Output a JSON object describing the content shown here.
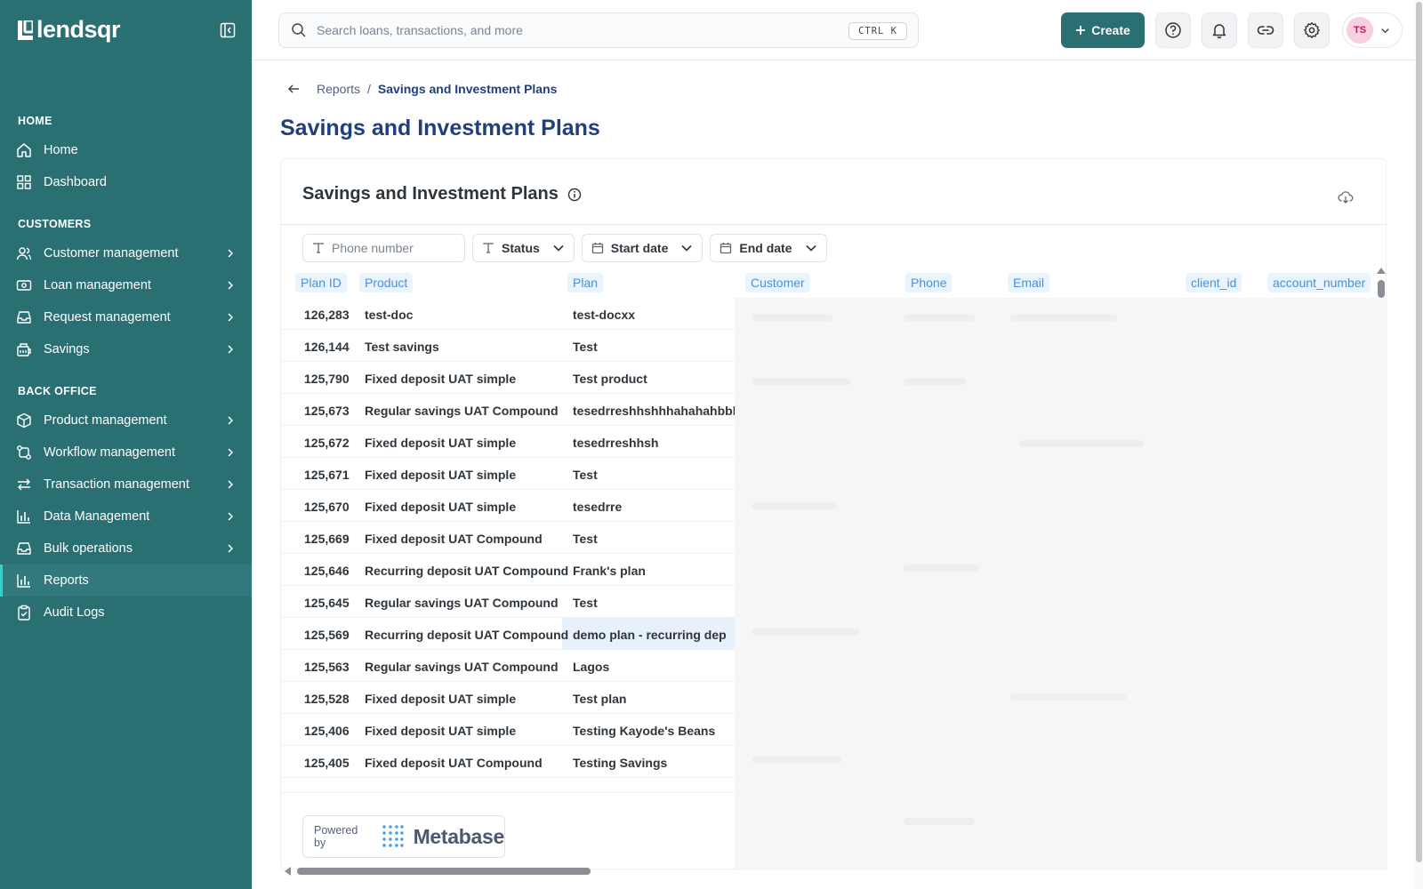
{
  "brand": {
    "name": "lendsqr"
  },
  "sidebar": {
    "sections": {
      "home": "HOME",
      "customers": "CUSTOMERS",
      "back_office": "BACK OFFICE"
    },
    "items": [
      {
        "label": "Home",
        "icon": "home-icon"
      },
      {
        "label": "Dashboard",
        "icon": "dashboard-icon"
      },
      {
        "label": "Customer management",
        "icon": "users-icon"
      },
      {
        "label": "Loan management",
        "icon": "loan-icon"
      },
      {
        "label": "Request management",
        "icon": "inbox-icon"
      },
      {
        "label": "Savings",
        "icon": "piggy-icon"
      },
      {
        "label": "Product management",
        "icon": "box-icon"
      },
      {
        "label": "Workflow management",
        "icon": "workflow-icon"
      },
      {
        "label": "Transaction management",
        "icon": "transfer-icon"
      },
      {
        "label": "Data Management",
        "icon": "bar-chart-icon"
      },
      {
        "label": "Bulk operations",
        "icon": "tray-icon"
      },
      {
        "label": "Reports",
        "icon": "report-icon"
      },
      {
        "label": "Audit Logs",
        "icon": "clipboard-icon"
      }
    ],
    "active": "Reports"
  },
  "topbar": {
    "search_placeholder": "Search loans, transactions, and more",
    "shortcut": "CTRL K",
    "create_label": "Create",
    "avatar_initials": "TS"
  },
  "breadcrumb": {
    "parent": "Reports",
    "separator": "/",
    "current": "Savings and Investment Plans"
  },
  "page_title": "Savings and Investment Plans",
  "card": {
    "title": "Savings and Investment Plans",
    "filters": {
      "phone_placeholder": "Phone number",
      "status": "Status",
      "start_date": "Start date",
      "end_date": "End date"
    },
    "columns": [
      "Plan ID",
      "Product",
      "Plan",
      "Customer",
      "Phone",
      "Email",
      "client_id",
      "account_number"
    ],
    "rows": [
      {
        "id": "126,283",
        "product": "test-doc",
        "plan": "test-docxx"
      },
      {
        "id": "126,144",
        "product": "Test savings",
        "plan": "Test"
      },
      {
        "id": "125,790",
        "product": "Fixed deposit UAT simple",
        "plan": "Test product"
      },
      {
        "id": "125,673",
        "product": "Regular savings UAT Compound",
        "plan": "tesedrreshhshhhahahahbbb"
      },
      {
        "id": "125,672",
        "product": "Fixed deposit UAT simple",
        "plan": "tesedrreshhsh"
      },
      {
        "id": "125,671",
        "product": "Fixed deposit UAT simple",
        "plan": "Test"
      },
      {
        "id": "125,670",
        "product": "Fixed deposit UAT simple",
        "plan": "tesedrre"
      },
      {
        "id": "125,669",
        "product": "Fixed deposit UAT Compound",
        "plan": "Test"
      },
      {
        "id": "125,646",
        "product": "Recurring deposit UAT Compound",
        "plan": "Frank's plan"
      },
      {
        "id": "125,645",
        "product": "Regular savings UAT Compound",
        "plan": "Test"
      },
      {
        "id": "125,569",
        "product": "Recurring deposit UAT Compound",
        "plan": "demo plan - recurring dep"
      },
      {
        "id": "125,563",
        "product": "Regular savings UAT Compound",
        "plan": "Lagos"
      },
      {
        "id": "125,528",
        "product": "Fixed deposit UAT simple",
        "plan": "Test plan"
      },
      {
        "id": "125,406",
        "product": "Fixed deposit UAT simple",
        "plan": "Testing Kayode's Beans"
      },
      {
        "id": "125,405",
        "product": "Fixed deposit UAT Compound",
        "plan": "Testing Savings"
      }
    ],
    "highlighted_row": "125,569"
  },
  "footer": {
    "powered_by": "Powered by",
    "metabase": "Metabase"
  },
  "colors": {
    "sidebar": "#2a6f72",
    "accent": "#39cdcc",
    "title": "#213f7d",
    "header_chip": "#4a90d9"
  }
}
